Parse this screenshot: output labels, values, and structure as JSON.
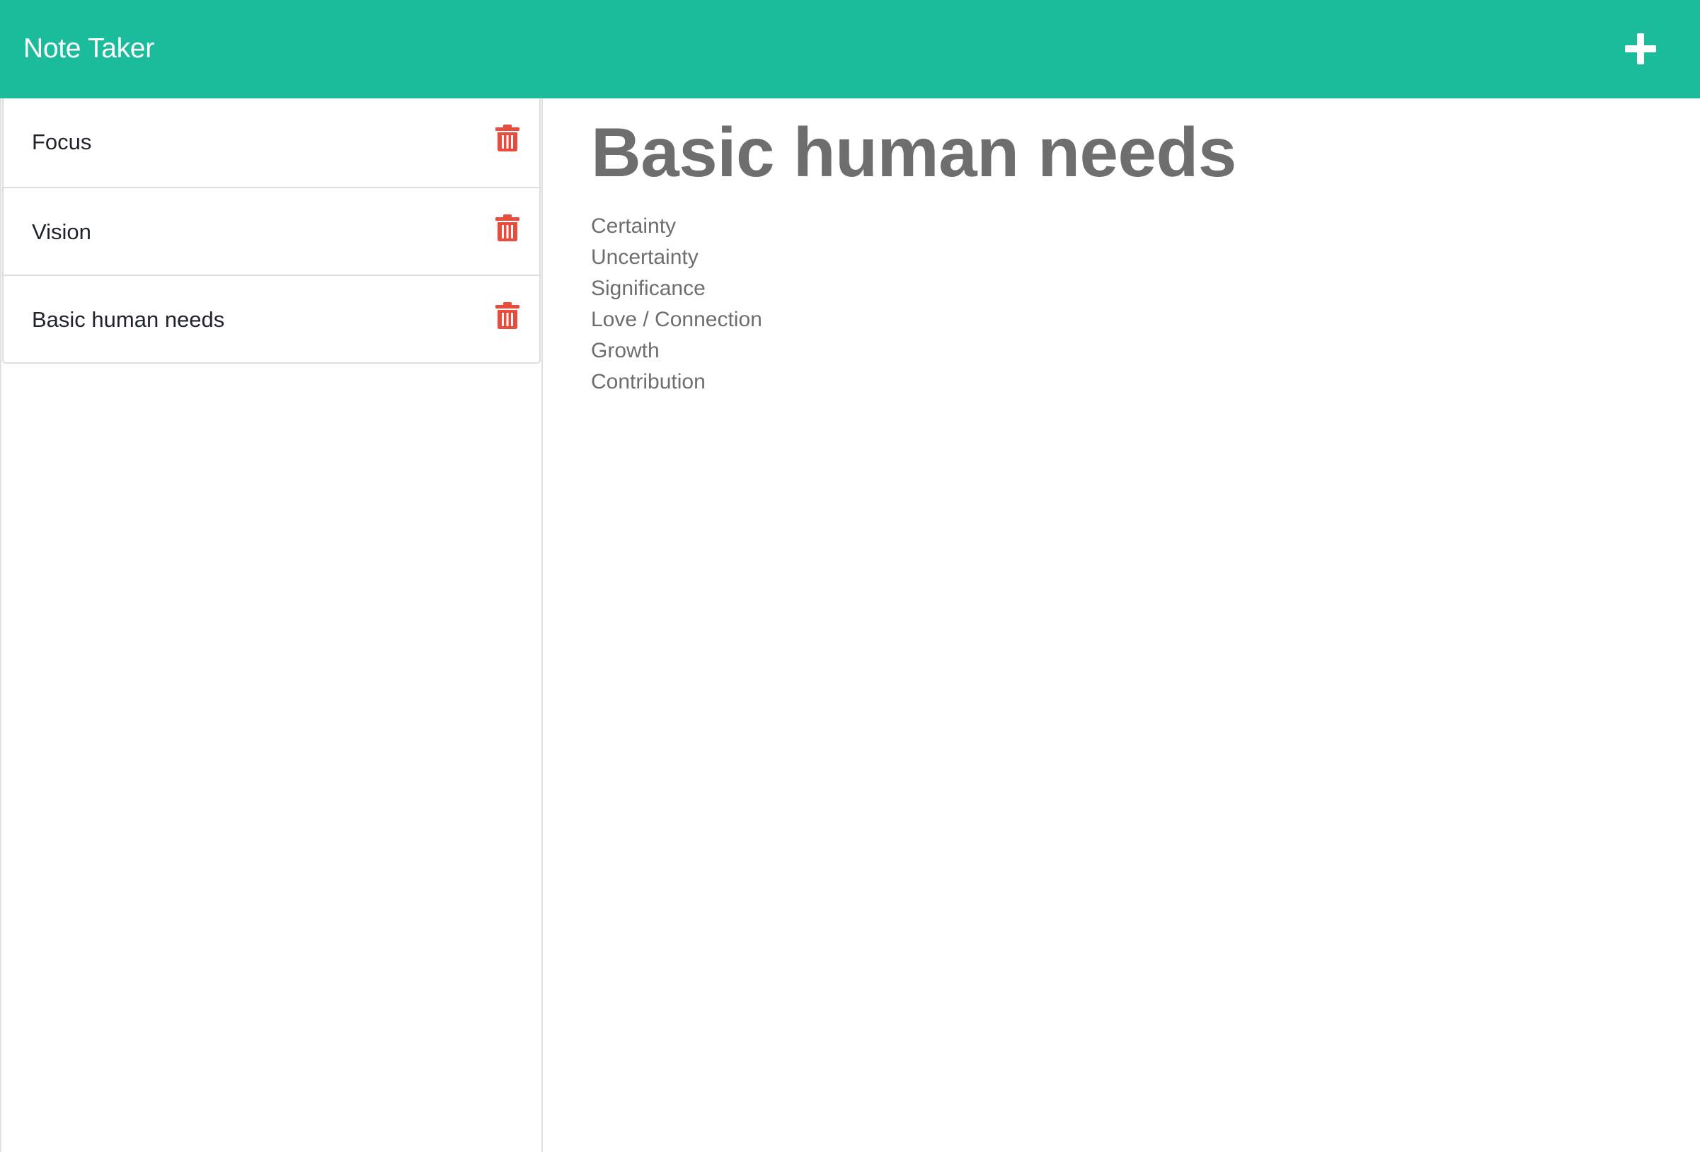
{
  "navbar": {
    "brand": "Note Taker",
    "new_note_icon": "plus-icon"
  },
  "sidebar": {
    "notes": [
      {
        "title": "Focus",
        "delete_icon": "trash-icon"
      },
      {
        "title": "Vision",
        "delete_icon": "trash-icon"
      },
      {
        "title": "Basic human needs",
        "delete_icon": "trash-icon"
      }
    ]
  },
  "main": {
    "title": "Basic human needs",
    "lines": [
      "Certainty",
      "Uncertainty",
      "Significance",
      "Love / Connection",
      "Growth",
      "Contribution"
    ]
  },
  "colors": {
    "navbar": "#1abc9c",
    "delete": "#e74c3c",
    "text_muted": "#6e6e6e"
  }
}
